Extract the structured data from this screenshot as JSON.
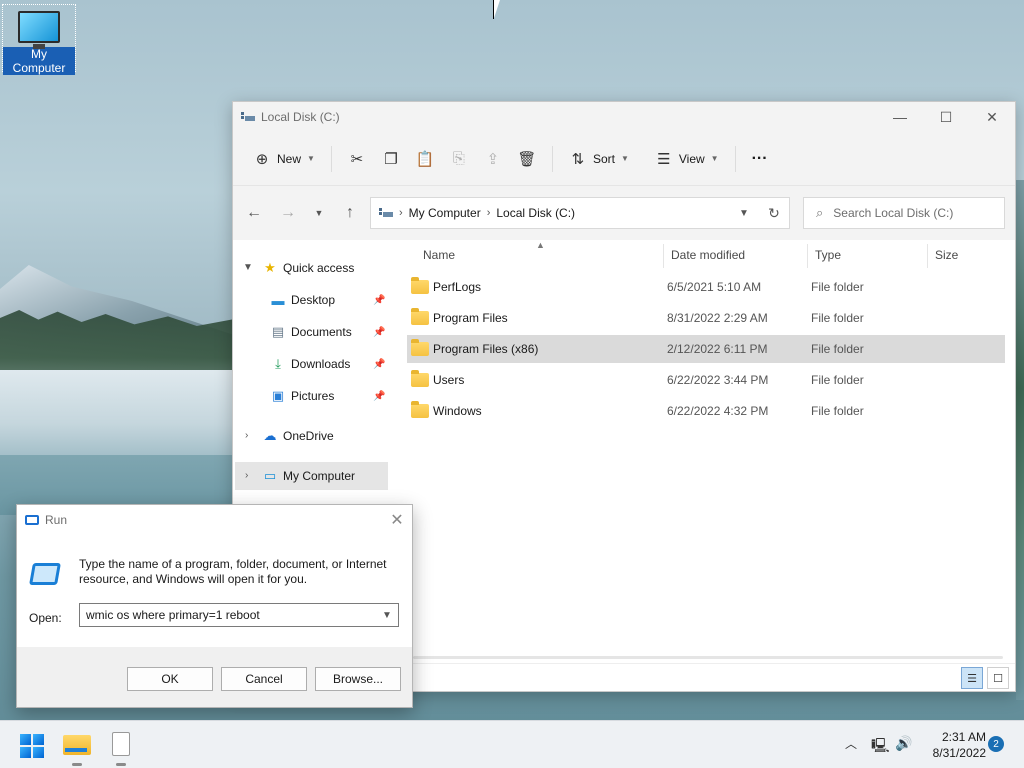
{
  "desktop": {
    "icon_label": "My Computer"
  },
  "explorer": {
    "title": "Local Disk (C:)",
    "controls": {
      "minimize": "—",
      "maximize": "☐",
      "close": "✕"
    },
    "toolbar": {
      "new_label": "New",
      "sort_label": "Sort",
      "view_label": "View",
      "more_label": "···"
    },
    "address": {
      "seg1": "My Computer",
      "seg2": "Local Disk (C:)"
    },
    "search": {
      "placeholder": "Search Local Disk (C:)"
    },
    "nav": {
      "quick_access": "Quick access",
      "desktop": "Desktop",
      "documents": "Documents",
      "downloads": "Downloads",
      "pictures": "Pictures",
      "onedrive": "OneDrive",
      "my_computer": "My Computer"
    },
    "columns": {
      "name": "Name",
      "date": "Date modified",
      "type": "Type",
      "size": "Size"
    },
    "files": [
      {
        "name": "PerfLogs",
        "date": "6/5/2021 5:10 AM",
        "type": "File folder"
      },
      {
        "name": "Program Files",
        "date": "8/31/2022 2:29 AM",
        "type": "File folder"
      },
      {
        "name": "Program Files (x86)",
        "date": "2/12/2022 6:11 PM",
        "type": "File folder"
      },
      {
        "name": "Users",
        "date": "6/22/2022 3:44 PM",
        "type": "File folder"
      },
      {
        "name": "Windows",
        "date": "6/22/2022 4:32 PM",
        "type": "File folder"
      }
    ]
  },
  "run": {
    "title": "Run",
    "description": "Type the name of a program, folder, document, or Internet resource, and Windows will open it for you.",
    "open_label": "Open:",
    "command": "wmic os where primary=1 reboot",
    "ok": "OK",
    "cancel": "Cancel",
    "browse": "Browse..."
  },
  "taskbar": {
    "time": "2:31 AM",
    "date": "8/31/2022",
    "notification_count": "2"
  }
}
